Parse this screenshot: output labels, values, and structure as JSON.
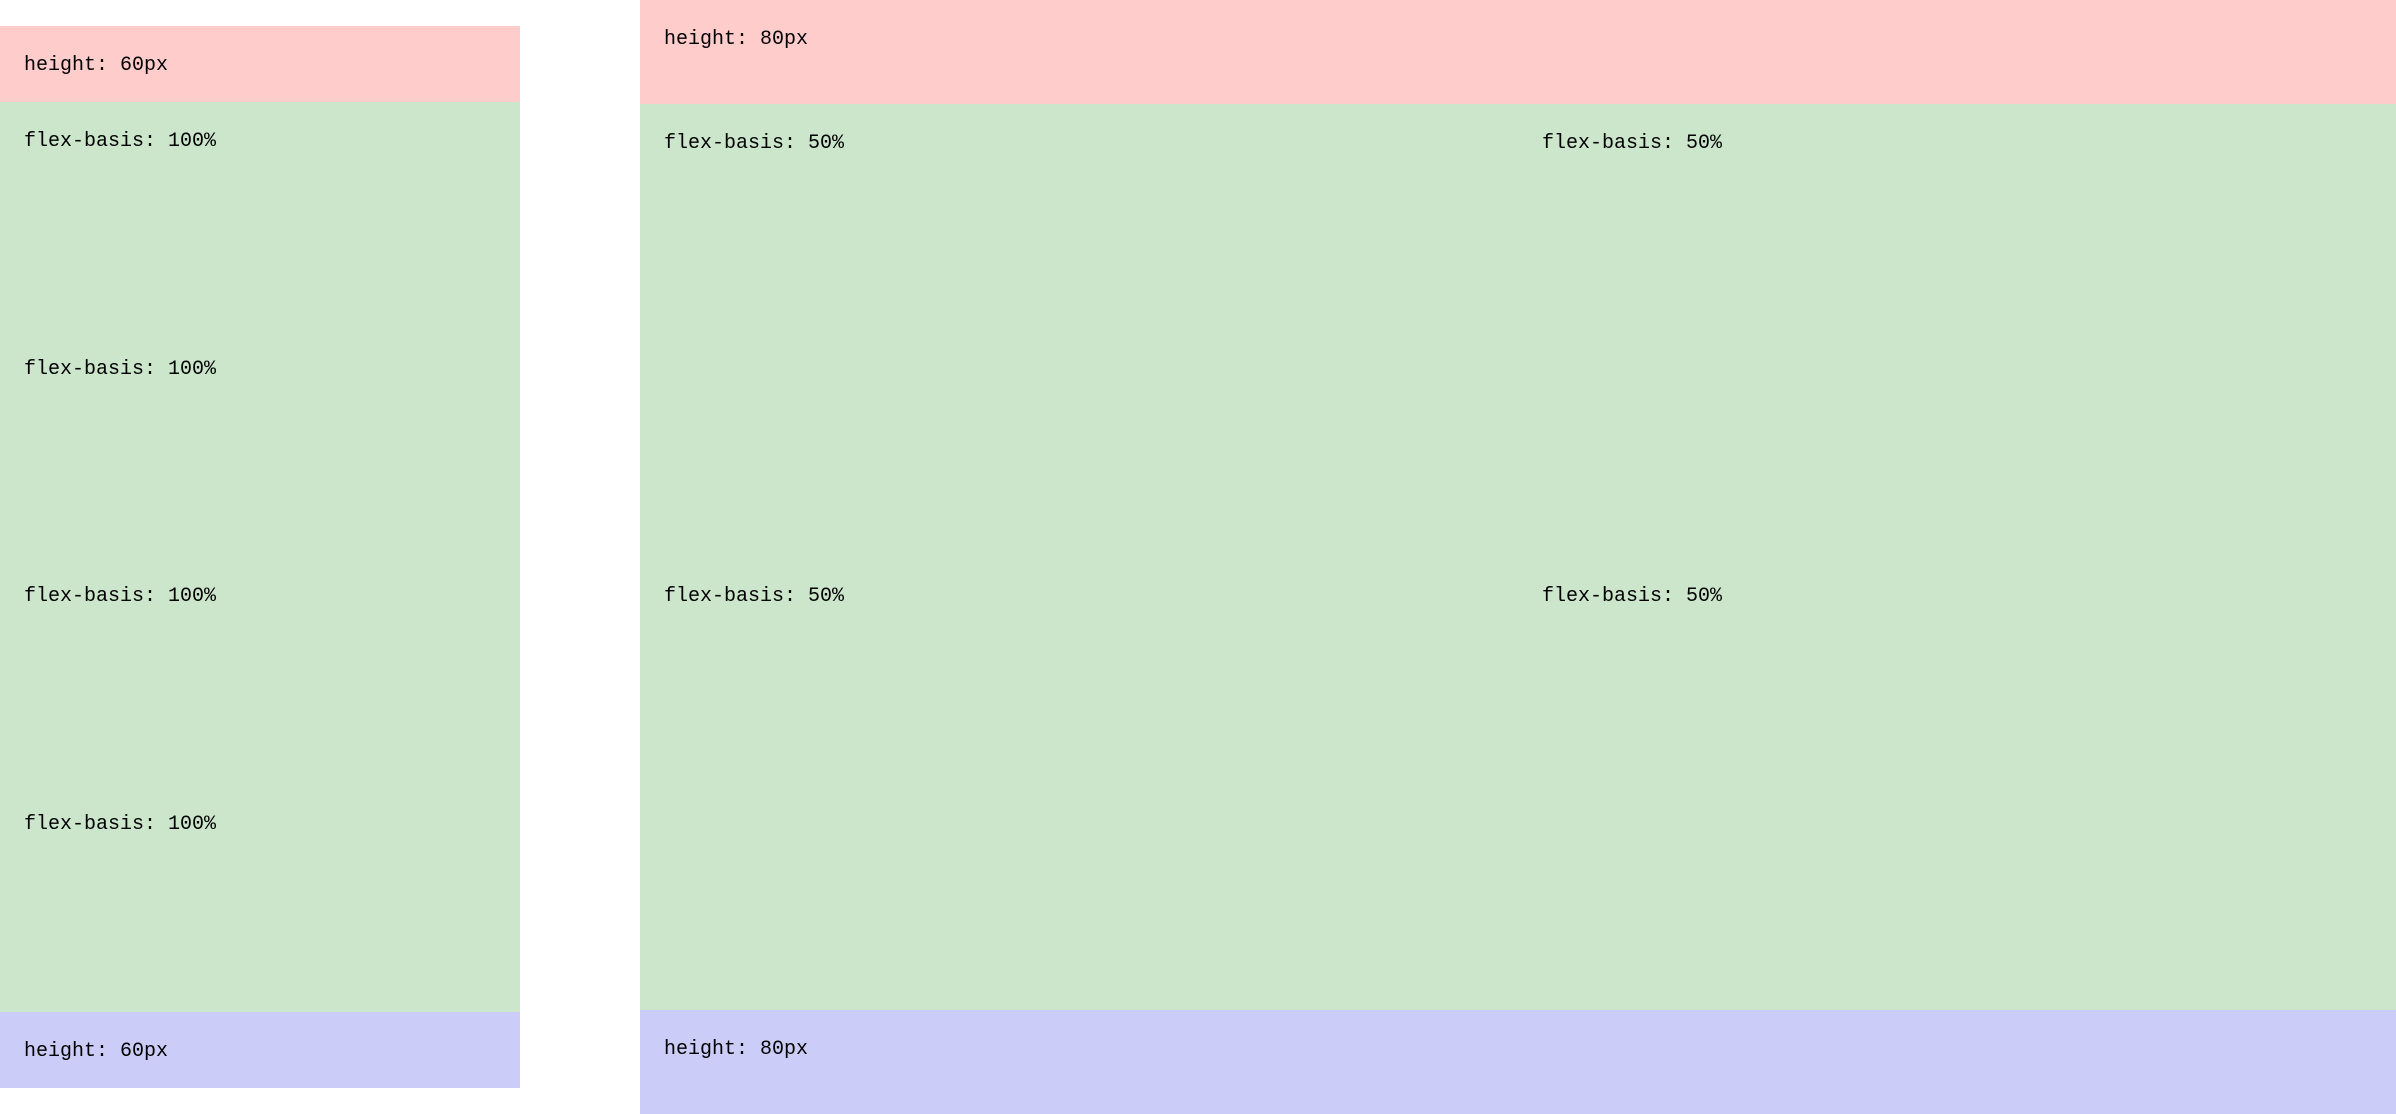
{
  "left": {
    "header": "height: 60px",
    "rows": [
      "flex-basis: 100%",
      "flex-basis: 100%",
      "flex-basis: 100%",
      "flex-basis: 100%"
    ],
    "footer": "height: 60px"
  },
  "right": {
    "header": "height: 80px",
    "rows": [
      "flex-basis: 50%",
      "flex-basis: 50%",
      "flex-basis: 50%",
      "flex-basis: 50%"
    ],
    "footer": "height: 80px"
  },
  "colors": {
    "header": "#ffcccc",
    "body": "#cce6cc",
    "footer": "#ccccf8"
  }
}
